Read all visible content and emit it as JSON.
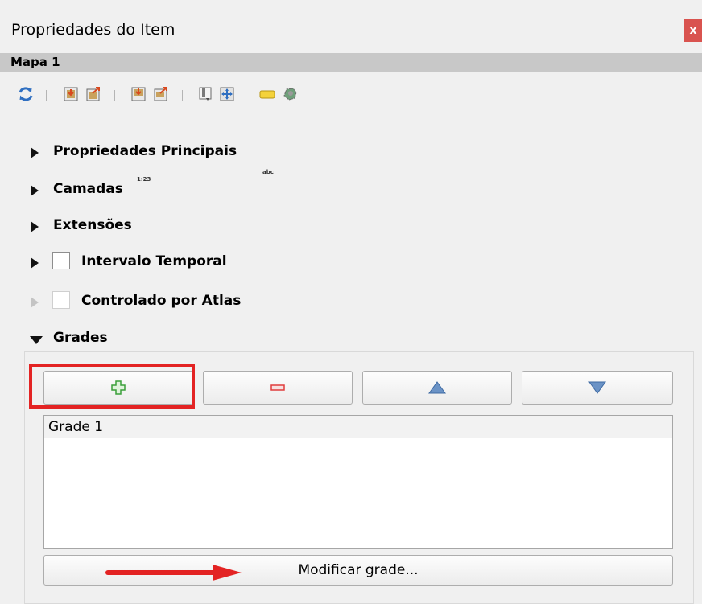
{
  "window": {
    "title": "Propriedades do Item",
    "close_label": "x"
  },
  "section": {
    "title": "Mapa 1"
  },
  "toolbar": {
    "icons": [
      "refresh-icon",
      "set-extent-to-map-view-icon",
      "view-extent-in-map-icon",
      "set-scale-to-map-icon",
      "view-scale-in-map-icon",
      "bookmark-icon",
      "set-map-extent-icon",
      "label-settings-icon",
      "clipping-settings-icon"
    ],
    "label_icon_text": "abc",
    "scale_icon_text": "1:23"
  },
  "groups": [
    {
      "label": "Propriedades Principais",
      "expanded": false,
      "enabled": true
    },
    {
      "label": "Camadas",
      "expanded": false,
      "enabled": true
    },
    {
      "label": "Extensões",
      "expanded": false,
      "enabled": true
    },
    {
      "label": "Intervalo Temporal",
      "expanded": false,
      "enabled": true,
      "checkable": true,
      "checked": false
    },
    {
      "label": "Controlado por Atlas",
      "expanded": false,
      "enabled": false,
      "checkable": true,
      "checked": false
    },
    {
      "label": "Grades",
      "expanded": true,
      "enabled": true
    }
  ],
  "grids": {
    "buttons": [
      "add-grid",
      "remove-grid",
      "move-up",
      "move-down"
    ],
    "items": [
      "Grade 1"
    ],
    "modify_label": "Modificar grade..."
  },
  "colors": {
    "close_bg": "#d9534f",
    "add_icon": "#3a9f3a",
    "remove_icon": "#e03c3c",
    "arrow_icon": "#5a84b8",
    "highlight": "#e32323"
  }
}
